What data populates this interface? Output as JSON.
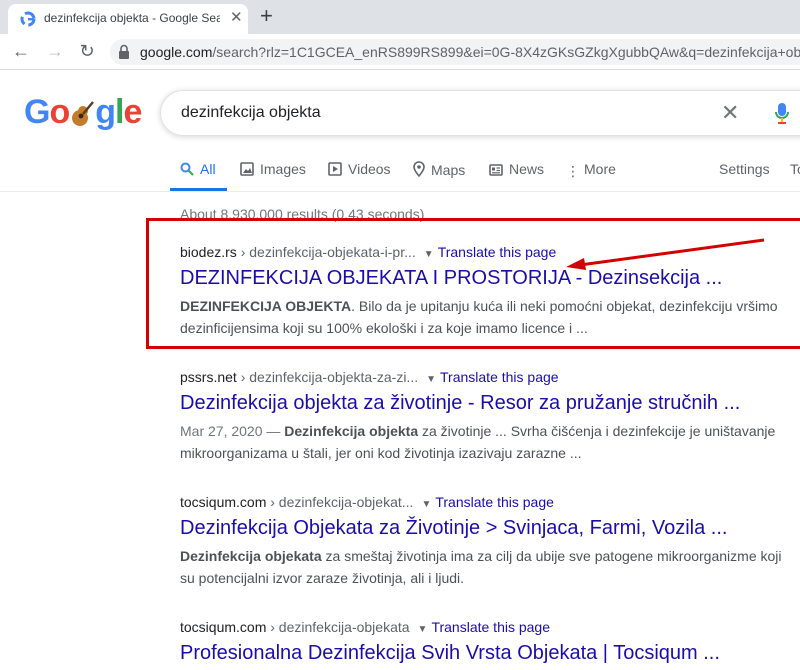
{
  "browser": {
    "tab_title": "dezinfekcija objekta - Google Search",
    "url_host": "google.com",
    "url_rest": "/search?rlz=1C1GCEA_enRS899RS899&ei=0G-8X4zGKsGZkgXgubbQAw&q=dezinfekcija+objekta"
  },
  "search": {
    "query": "dezinfekcija objekta"
  },
  "tabs": {
    "all": "All",
    "images": "Images",
    "videos": "Videos",
    "maps": "Maps",
    "news": "News",
    "more": "More",
    "settings": "Settings",
    "tools": "Tools"
  },
  "stats": "About 8,930,000 results (0.43 seconds)",
  "translate_label": "Translate this page",
  "results": [
    {
      "domain": "biodez.rs",
      "path": " › dezinfekcija-objekata-i-pr...",
      "title": "DEZINFEKCIJA OBJEKATA I PROSTORIJA - Dezinsekcija ...",
      "snippet_bold": "DEZINFEKCIJA OBJEKTA",
      "snippet_line1": ". Bilo da je upitanju kuća ili neki pomoćni objekat, dezinfekciju vršimo",
      "snippet_line2": "dezinficijensima koji su 100% ekološki i za koje imamo licence i ..."
    },
    {
      "domain": "pssrs.net",
      "path": " › dezinfekcija-objekta-za-zi...",
      "title": "Dezinfekcija objekta za životinje - Resor za pružanje stručnih ...",
      "date": "Mar 27, 2020 — ",
      "snippet_bold": "Dezinfekcija objekta",
      "snippet_line1": " za životinje ... Svrha čišćenja i dezinfekcije je uništavanje",
      "snippet_line2": "mikroorganizama u štali, jer oni kod životinja izazivaju zarazne ..."
    },
    {
      "domain": "tocsiqum.com",
      "path": " › dezinfekcija-objekat...",
      "title": "Dezinfekcija Objekata za Životinje > Svinjaca, Farmi, Vozila ...",
      "snippet_bold": "Dezinfekcija objekata",
      "snippet_line1": " za smeštaj životinja ima za cilj da ubije sve patogene mikroorganizme koji",
      "snippet_line2": "su potencijalni izvor zaraze životinja, ali i ljudi."
    },
    {
      "domain": "tocsiqum.com",
      "path": " › dezinfekcija-objekata",
      "title": "Profesionalna Dezinfekcija Svih Vrsta Objekata | Tocsiqum ..."
    }
  ],
  "colors": {
    "link": "#1a0dab",
    "accent": "#1a73e8",
    "annotation": "#d40000"
  }
}
